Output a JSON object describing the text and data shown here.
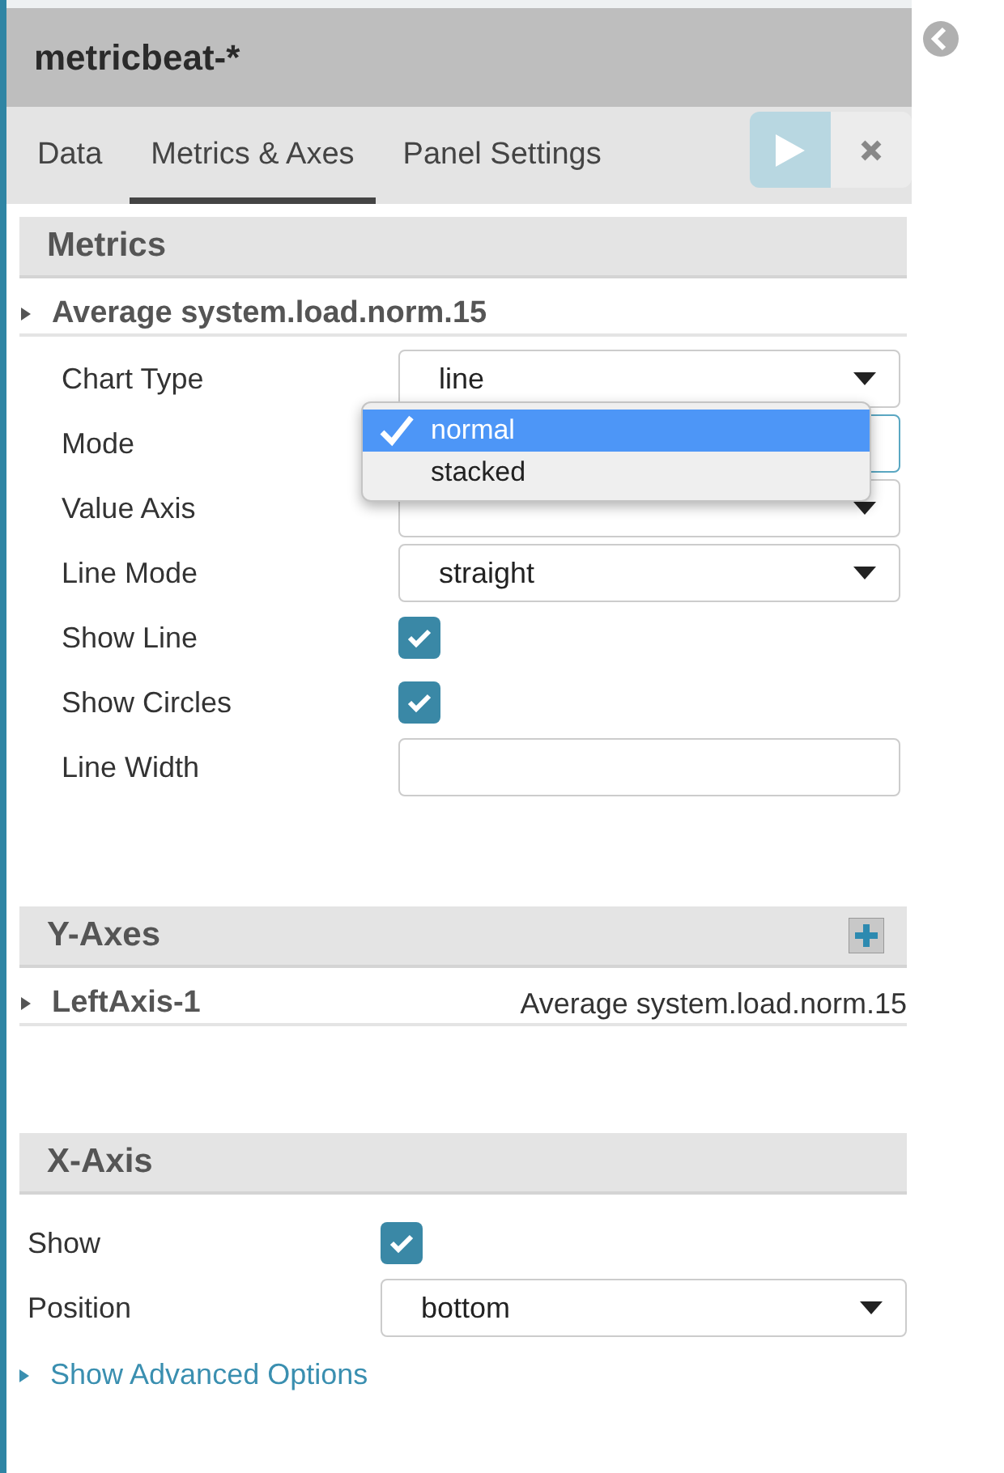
{
  "header": {
    "title": "metricbeat-*"
  },
  "tabs": [
    {
      "label": "Data",
      "selected": false
    },
    {
      "label": "Metrics & Axes",
      "selected": true
    },
    {
      "label": "Panel Settings",
      "selected": false
    }
  ],
  "metrics": {
    "title": "Metrics",
    "agg": {
      "label": "Average system.load.norm.15",
      "expanded": false
    },
    "fields": [
      {
        "kind": "select",
        "label": "Chart Type",
        "value": "line"
      },
      {
        "kind": "select",
        "label": "Mode",
        "open": true,
        "options": [
          {
            "label": "normal",
            "selected": true
          },
          {
            "label": "stacked",
            "selected": false
          }
        ]
      },
      {
        "kind": "select",
        "label": "Value Axis"
      },
      {
        "kind": "select",
        "label": "Line Mode",
        "value": "straight"
      },
      {
        "kind": "checkbox",
        "label": "Show Line",
        "checked": true
      },
      {
        "kind": "checkbox",
        "label": "Show Circles",
        "checked": true
      },
      {
        "kind": "input",
        "label": "Line Width"
      }
    ]
  },
  "y_axes": {
    "title": "Y-Axes",
    "axes": [
      {
        "name": "LeftAxis-1",
        "series": "Average system.load.norm.15",
        "expanded": false
      }
    ]
  },
  "x_axis": {
    "title": "X-Axis",
    "fields": [
      {
        "kind": "checkbox",
        "label": "Show",
        "checked": true
      },
      {
        "kind": "select",
        "label": "Position",
        "value": "bottom"
      }
    ],
    "advanced_link": "Show Advanced Options"
  }
}
